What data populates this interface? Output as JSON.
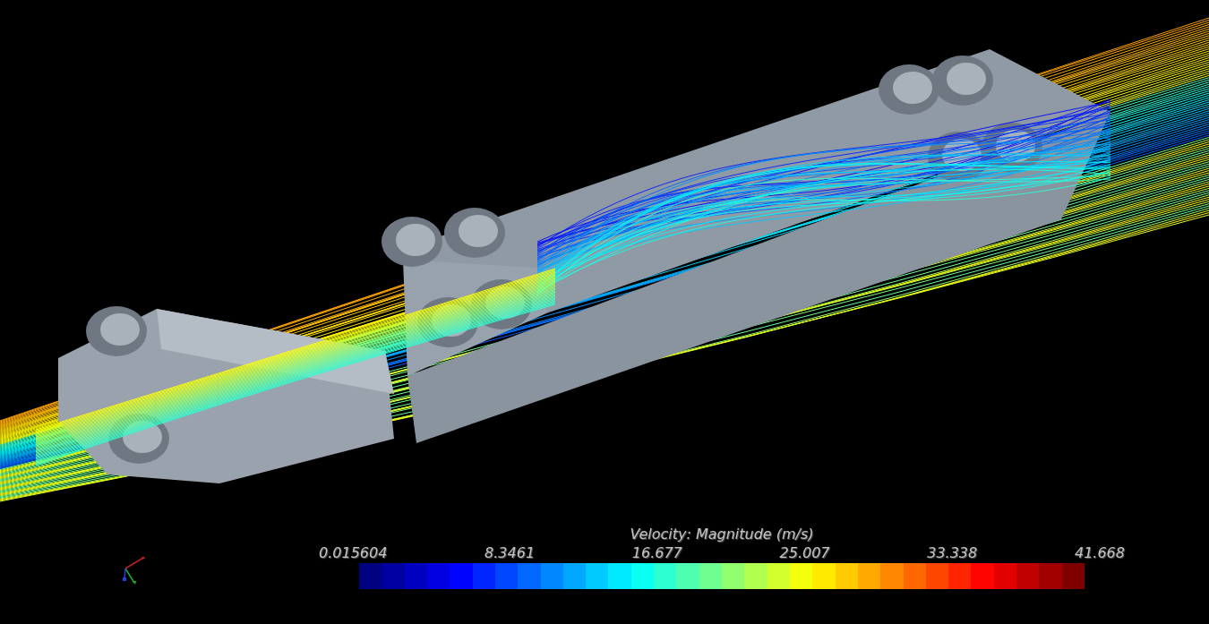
{
  "legend": {
    "title": "Velocity: Magnitude (m/s)",
    "tick_labels": [
      "0.015604",
      "8.3461",
      "16.677",
      "25.007",
      "33.338",
      "41.668"
    ]
  }
}
